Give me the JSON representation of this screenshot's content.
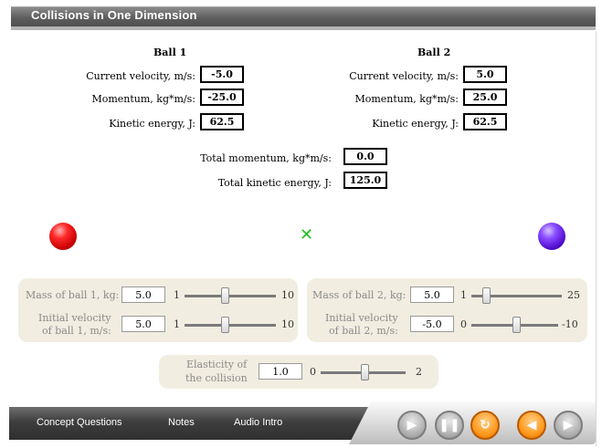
{
  "window": {
    "title": "Collisions in One Dimension"
  },
  "ball1": {
    "heading": "Ball 1",
    "velocity_label": "Current velocity, m/s:",
    "velocity_value": "-5.0",
    "momentum_label": "Momentum, kg*m/s:",
    "momentum_value": "-25.0",
    "energy_label": "Kinetic energy, J:",
    "energy_value": "62.5"
  },
  "ball2": {
    "heading": "Ball 2",
    "velocity_label": "Current velocity, m/s:",
    "velocity_value": "5.0",
    "momentum_label": "Momentum, kg*m/s:",
    "momentum_value": "25.0",
    "energy_label": "Kinetic energy, J:",
    "energy_value": "62.5"
  },
  "totals": {
    "momentum_label": "Total momentum, kg*m/s:",
    "momentum_value": "0.0",
    "energy_label": "Total kinetic energy, J:",
    "energy_value": "125.0"
  },
  "scene": {
    "center_marker": "✕"
  },
  "controls": {
    "mass1": {
      "label": "Mass of ball 1, kg:",
      "value": "5.0",
      "min": "1",
      "max": "10"
    },
    "vel1": {
      "label_line1": "Initial velocity",
      "label_line2": "of ball 1, m/s:",
      "value": "5.0",
      "min": "1",
      "max": "10"
    },
    "mass2": {
      "label": "Mass of ball 2, kg:",
      "value": "5.0",
      "min": "1",
      "max": "25"
    },
    "vel2": {
      "label_line1": "Initial velocity",
      "label_line2": "of ball 2, m/s:",
      "value": "-5.0",
      "min": "0",
      "max": "-10"
    },
    "elasticity": {
      "label_line1": "Elasticity of",
      "label_line2": "the collision",
      "value": "1.0",
      "min": "0",
      "max": "2"
    }
  },
  "nav": {
    "concept": "Concept Questions",
    "notes": "Notes",
    "audio": "Audio Intro"
  },
  "playback": {
    "play_icon": "play-icon",
    "pause_icon": "pause-icon",
    "replay_icon": "replay-icon",
    "rewind_icon": "skip-to-start-icon",
    "end_icon": "skip-to-end-icon",
    "accent_color": "#ff9a1e"
  }
}
